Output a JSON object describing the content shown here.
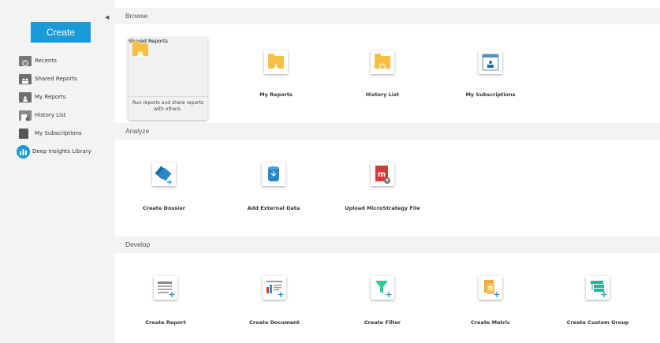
{
  "sidebar": {
    "collapse_glyph": "◀",
    "create_label": "Create",
    "items": [
      {
        "label": "Recents",
        "icon": "recents-icon"
      },
      {
        "label": "Shared Reports",
        "icon": "shared-reports-icon"
      },
      {
        "label": "My Reports",
        "icon": "my-reports-icon"
      },
      {
        "label": "History List",
        "icon": "history-list-icon"
      },
      {
        "label": "My Subscriptions",
        "icon": "my-subscriptions-icon"
      },
      {
        "label": "Deep Insights Library",
        "icon": "deep-insights-library-icon"
      }
    ]
  },
  "sections": {
    "browse": {
      "title": "Browse",
      "tiles": [
        {
          "label": "Shared Reports",
          "description": "Run reports and share reports with others."
        },
        {
          "label": "My Reports"
        },
        {
          "label": "History List"
        },
        {
          "label": "My Subscriptions"
        }
      ]
    },
    "analyze": {
      "title": "Analyze",
      "tiles": [
        {
          "label": "Create Dossier"
        },
        {
          "label": "Add External Data"
        },
        {
          "label": "Upload MicroStrategy File"
        }
      ]
    },
    "develop": {
      "title": "Develop",
      "tiles": [
        {
          "label": "Create Report"
        },
        {
          "label": "Create Document"
        },
        {
          "label": "Create Filter"
        },
        {
          "label": "Create Metric"
        },
        {
          "label": "Create Custom Group"
        }
      ]
    }
  },
  "colors": {
    "accent": "#1a9bd7",
    "folder": "#f6c142",
    "red": "#d9383a",
    "green": "#2ecc8f",
    "teal": "#1bb894",
    "orange": "#f2a93b"
  }
}
